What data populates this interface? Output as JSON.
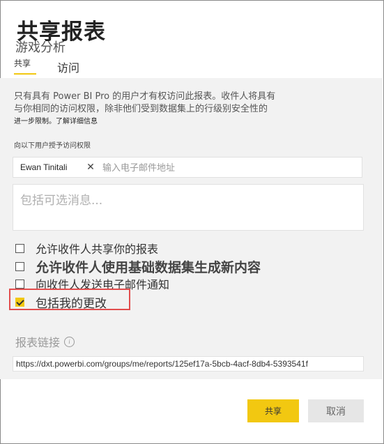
{
  "dialog": {
    "title": "共享报表",
    "subtitle": "游戏分析"
  },
  "tabs": [
    {
      "label": "共享",
      "active": true
    },
    {
      "label": "访问",
      "active": false
    }
  ],
  "description": {
    "line1": "只有具有 Power BI Pro 的用户才有权访问此报表。收件人将具有",
    "line2": "与你相同的访问权限，除非他们受到数据集上的行级别安全性的",
    "line3": "进一步限制。",
    "learn_more": "了解详细信息"
  },
  "grant_label": "向以下用户授予访问权限",
  "recipients": [
    {
      "name": "Ewan Tinitali"
    }
  ],
  "email_placeholder": "输入电子邮件地址",
  "message_placeholder": "包括可选消息...",
  "options": [
    {
      "label": "允许收件人共享你的报表",
      "checked": false
    },
    {
      "label": "允许收件人使用基础数据集生成新内容",
      "checked": false
    },
    {
      "label": "向收件人发送电子邮件通知",
      "checked": false
    },
    {
      "label": "包括我的更改",
      "checked": true
    }
  ],
  "report_link": {
    "label": "报表链接",
    "url": "https://dxt.powerbi.com/groups/me/reports/125ef17a-5bcb-4acf-8db4-5393541f"
  },
  "buttons": {
    "share": "共享",
    "cancel": "取消"
  },
  "colors": {
    "accent": "#f2c811",
    "highlight_border": "#e24d4d",
    "panel_bg": "#f2f2f2"
  }
}
